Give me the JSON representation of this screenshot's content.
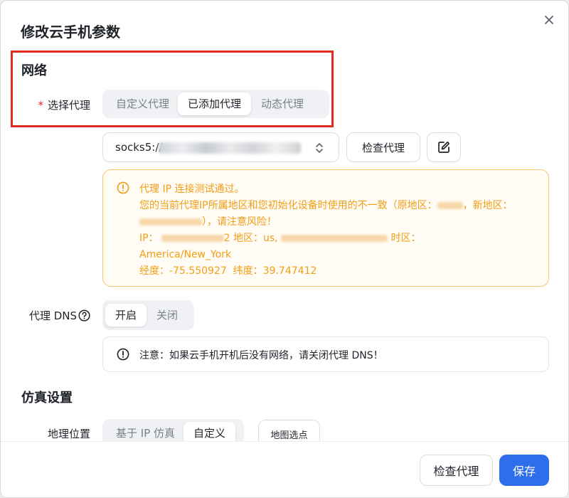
{
  "dialog": {
    "title": "修改云手机参数"
  },
  "network": {
    "section_title": "网络",
    "proxy_label": "选择代理",
    "required_mark": "*",
    "proxy_modes": [
      "自定义代理",
      "已添加代理",
      "动态代理"
    ],
    "active_mode": "已添加代理",
    "proxy_value": "socks5://",
    "check_proxy_label": "检查代理",
    "edit_icon": "edit-icon",
    "warning": {
      "line1": "代理 IP 连接测试通过。",
      "line2_a": "您的当前代理IP所属地区和您初始化设备时使用的不一致（原地区：",
      "line2_b": "，新地区：",
      "line3": "），请注意风险！",
      "line4_ip_label": "IP：",
      "line4_ip_tail": "2",
      "line4_region": "地区：us,",
      "line4_tz": "时区：",
      "line5": "America/New_York",
      "line6_lon_label": "经度：-75.550927",
      "line6_lat_label": "纬度：39.747412"
    },
    "dns_label": "代理 DNS",
    "dns_options": [
      "开启",
      "关闭"
    ],
    "dns_active": "开启",
    "dns_note": "注意：如果云手机开机后没有网络，请关闭代理 DNS！"
  },
  "simulation": {
    "section_title": "仿真设置",
    "location_label": "地理位置",
    "location_options": [
      "基于 IP 仿真",
      "自定义"
    ],
    "location_active": "自定义",
    "map_pick_label": "地图选点"
  },
  "footer": {
    "check_proxy_label": "检查代理",
    "save_label": "保存"
  },
  "colors": {
    "primary": "#2f6eeb",
    "warning_text": "#f29d16",
    "warning_border": "#f5c66b",
    "required": "#e0291f",
    "highlight": "#e0291f"
  }
}
